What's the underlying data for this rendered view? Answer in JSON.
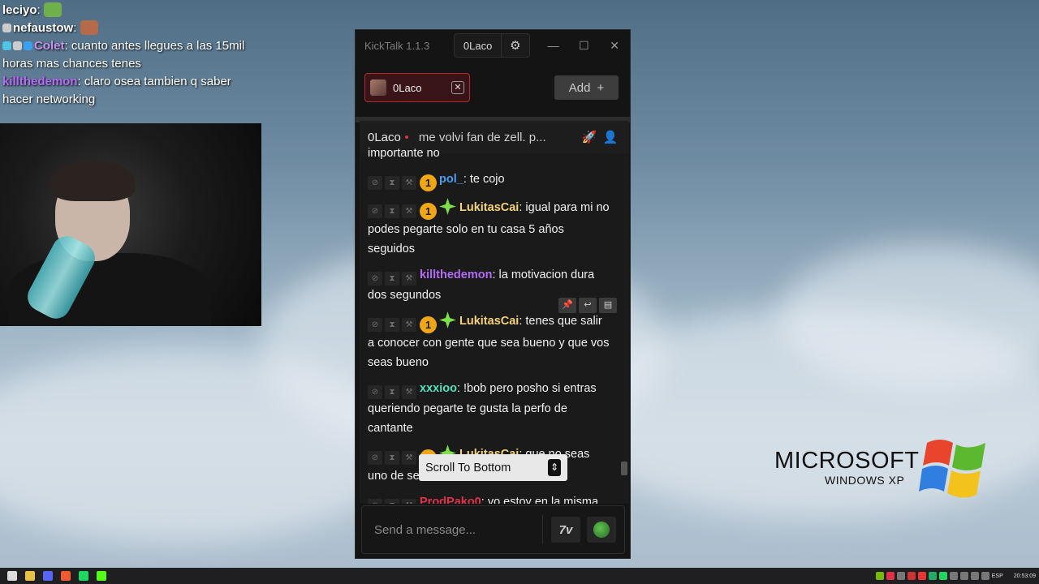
{
  "overlay_chat": [
    {
      "user": "leciyo",
      "user_color": "#ffffff",
      "message": "",
      "emote": "pepe-emote"
    },
    {
      "user": "nefaustow",
      "user_color": "#ffffff",
      "message": "",
      "emote": "face-emote"
    },
    {
      "user": "Colet",
      "user_color": "#c792ea",
      "message": "cuanto antes llegues a las 15mil horas mas chances tenes",
      "emote": ""
    },
    {
      "user": "killthedemon",
      "user_color": "#b56cf5",
      "message": "claro osea tambien q saber hacer networking",
      "emote": ""
    }
  ],
  "app": {
    "title": "KickTalk 1.1.3",
    "user_tab": "0Laco",
    "settings_icon": "gear-icon",
    "minimize": "—",
    "maximize": "☐",
    "close": "✕"
  },
  "tabs": {
    "active_label": "0Laco",
    "close_label": "✕",
    "add_label": "Add",
    "add_icon": "+"
  },
  "channel": {
    "name": "0Laco",
    "title": "me volvi fan de zell. p..."
  },
  "messages": [
    {
      "cut": true,
      "user": "",
      "color": "",
      "text": "importante no",
      "sub": false,
      "gift": false
    },
    {
      "cut": false,
      "user": "pol_",
      "color": "#4a9df2",
      "text": "te cojo",
      "sub": true,
      "sub_months": "1",
      "gift": false
    },
    {
      "cut": false,
      "user": "LukitasCai",
      "color": "#f5d27a",
      "text": "igual para mi no podes pegarte solo en tu casa 5 años seguidos",
      "sub": true,
      "sub_months": "1",
      "gift": true
    },
    {
      "cut": false,
      "user": "killthedemon",
      "color": "#b56cf5",
      "text": "la motivacion dura dos segundos",
      "sub": false,
      "gift": false
    },
    {
      "cut": false,
      "user": "LukitasCai",
      "color": "#f5d27a",
      "text": "tenes que salir a conocer con gente que sea bueno y que vos seas bueno",
      "sub": true,
      "sub_months": "1",
      "gift": true
    },
    {
      "cut": false,
      "user": "xxxioo",
      "color": "#4fe3b8",
      "text": "!bob pero posho si entras queriendo pegarte te gusta la perfo de cantante",
      "sub": false,
      "gift": false
    },
    {
      "cut": false,
      "user": "LukitasCai",
      "color": "#f5d27a",
      "text": "que no seas uno de se",
      "sub": true,
      "sub_months": "1",
      "gift": true
    },
    {
      "cut": false,
      "user": "ProdPako0",
      "color": "#e0304a",
      "text": "yo estoy en la misma",
      "sub": false,
      "gift": false
    }
  ],
  "scroll_to_bottom": "Scroll To Bottom",
  "input": {
    "placeholder": "Send a message...",
    "emote_7tv": "7v"
  },
  "desktop": {
    "logo_word": "MICROSOFT",
    "logo_sub": "WINDOWS XP"
  },
  "taskbar": {
    "lang": "ESP",
    "time": "20:53:09"
  }
}
